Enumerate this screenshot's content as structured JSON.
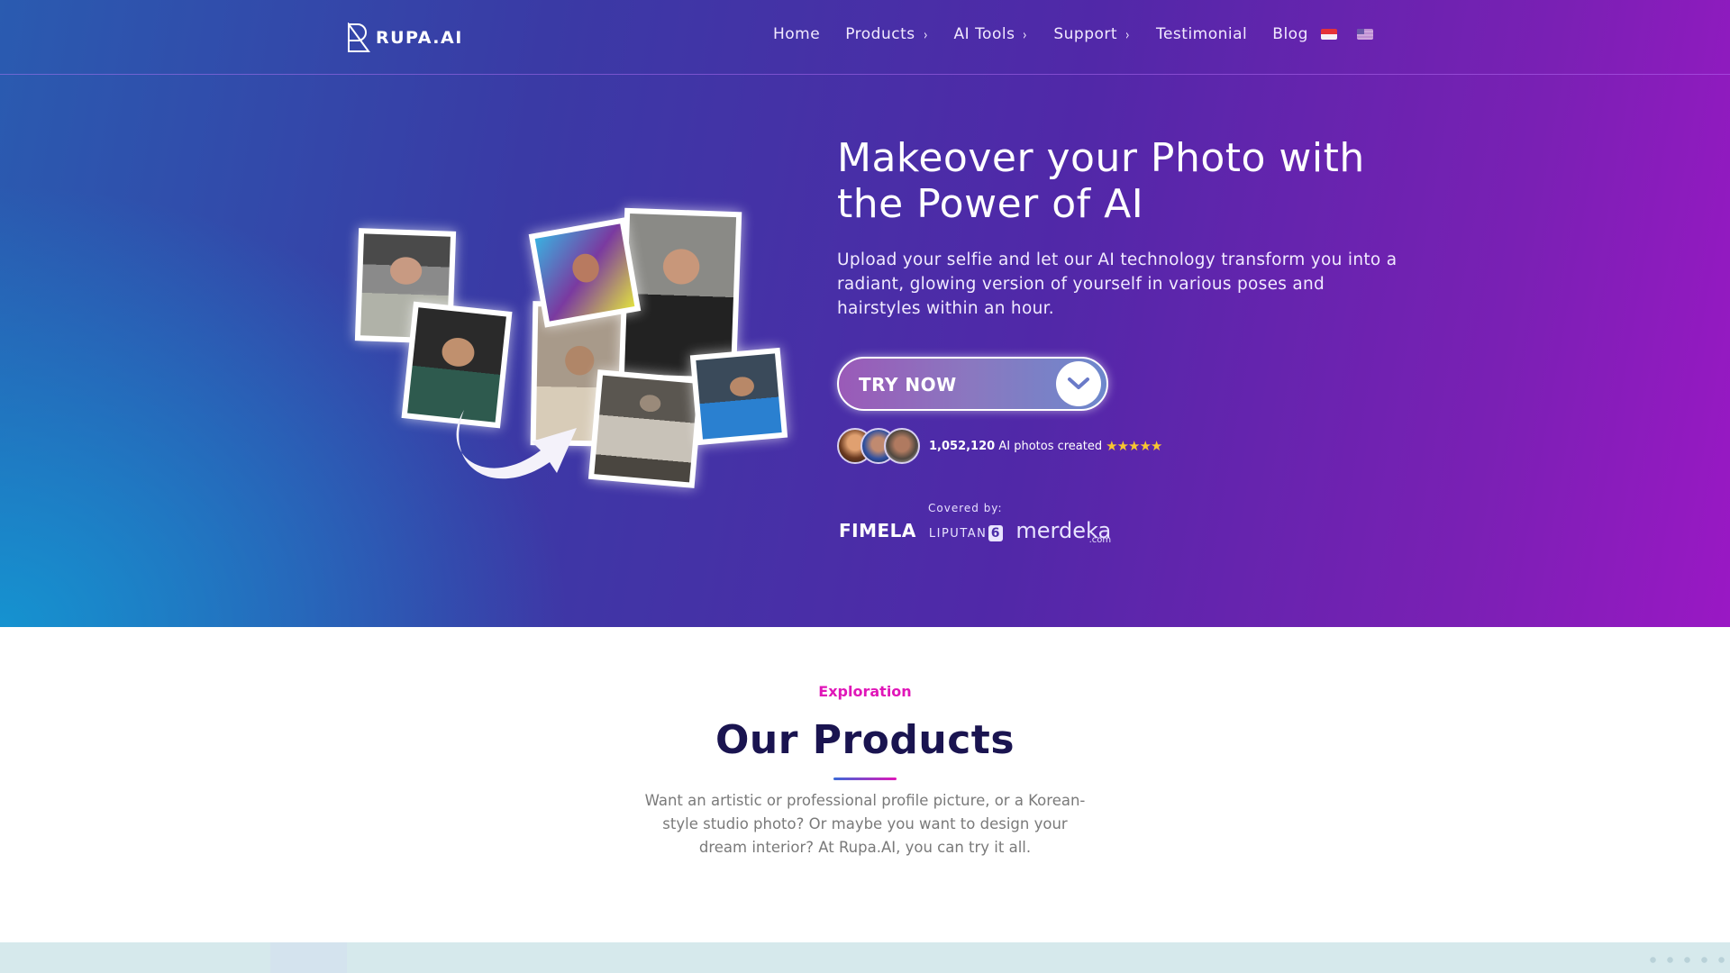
{
  "brand": {
    "name": "RUPA.AI"
  },
  "nav": {
    "items": [
      {
        "label": "Home",
        "has_dropdown": false
      },
      {
        "label": "Products",
        "has_dropdown": true
      },
      {
        "label": "AI Tools",
        "has_dropdown": true
      },
      {
        "label": "Support",
        "has_dropdown": true
      },
      {
        "label": "Testimonial",
        "has_dropdown": false
      },
      {
        "label": "Blog",
        "has_dropdown": false
      }
    ],
    "chevron_glyph": "›",
    "languages": [
      {
        "code": "id",
        "icon": "indonesia-flag-icon"
      },
      {
        "code": "en",
        "icon": "us-flag-icon"
      }
    ]
  },
  "hero": {
    "headline": "Makeover your Photo with the Power of AI",
    "subtext": "Upload your selfie and let our AI technology transform you into a radiant, glowing version of yourself in various poses and hairstyles within an hour.",
    "cta_label": "TRY NOW",
    "cta_icon": "chevron-down-icon",
    "stats": {
      "count": "1,052,120",
      "label": "AI photos created",
      "stars": "★★★★★",
      "rating": 5
    },
    "covered_by_label": "Covered by:",
    "press": {
      "fimela": "FIMELA",
      "liputan": "LIPUTAN",
      "liputan_num": "6",
      "merdeka": "merdeka",
      "merdeka_suffix": ".com"
    }
  },
  "products": {
    "eyebrow": "Exploration",
    "title": "Our Products",
    "description": "Want an artistic or professional profile picture, or a Korean-style studio photo? Or maybe you want to design your dream interior? At Rupa.AI, you can try it all."
  },
  "colors": {
    "accent_pink": "#e016b8",
    "title_navy": "#1a1450",
    "hero_purple": "#7a20b4",
    "hero_blue": "#1496d2",
    "star_gold": "#f8c630"
  }
}
